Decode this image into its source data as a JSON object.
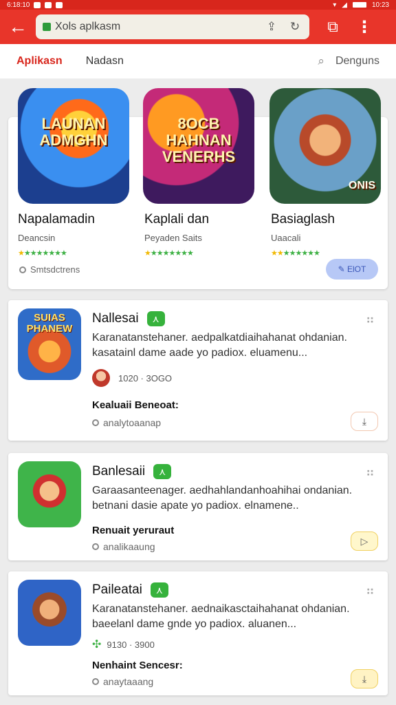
{
  "status": {
    "left": "6:18:10",
    "right": "10:23"
  },
  "address_bar": {
    "url": "Xols aplkasm"
  },
  "tabs": {
    "active": "Aplikasn",
    "second": "Nadasn",
    "right": "Denguns"
  },
  "featured": [
    {
      "art_text": "LAUNAN ADMGHN",
      "title": "Napalamadin",
      "subtitle": "Deancsin",
      "rating": 4.5
    },
    {
      "art_text": "8OCB HAHNAN VENERHS",
      "title": "Kaplali dan",
      "subtitle": "Peyaden Saits",
      "rating": 4.5
    },
    {
      "art_text": "ONIS",
      "title": "Basiaglash",
      "subtitle": "Uaacali",
      "rating": 4.5
    }
  ],
  "featured_footer": {
    "text": "Smtsdctrens",
    "button": "ElOT"
  },
  "cards": [
    {
      "thumb_text": "SUIAS PHANEW",
      "title": "Nallesai",
      "desc": "Karanatanstehaner. aedpalkatdiaihahanat ohdanian. kasatainl dame aade yo padiox. eluamenu...",
      "meta": "1020 · 3OGO",
      "subtitle_bold": "Kealuaii Beneoat:",
      "developer": "analytoaanap"
    },
    {
      "thumb_text": "",
      "title": "Banlesaii",
      "desc": "Garaasanteenager. aedhahlandanhoahihai ondanian. betnani dasie apate yo padiox. elnamene..",
      "meta": "",
      "subtitle_bold": "Renuait yeruraut",
      "developer": "analikaaung"
    },
    {
      "thumb_text": "",
      "title": "Paileatai",
      "desc": "Karanatanstehaner. aednaikasctaihahanat ohdanian. baeelanl dame gnde yo padiox. aluanen...",
      "meta": "9130 · 3900",
      "subtitle_bold": "Nenhaint Sencesr:",
      "developer": "anaytaaang"
    }
  ],
  "colors": {
    "brand": "#e8352a",
    "verified": "#36b23c"
  }
}
